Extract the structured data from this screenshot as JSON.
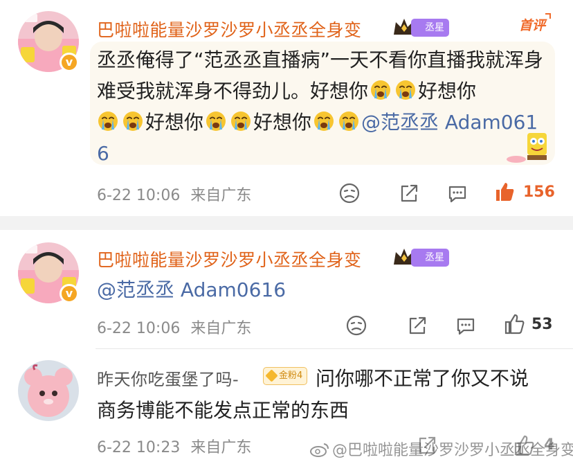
{
  "colors": {
    "username": "#e0631a",
    "mention": "#4a6aa5",
    "like_active": "#e8632b",
    "fan_tag": "#a77af0",
    "bubble": "#fcf8ef"
  },
  "comments": [
    {
      "username": "巴啦啦能量沙罗沙罗小丞丞全身变",
      "fan_tag": "丞星",
      "top_label": "首评",
      "text_parts": [
        "丞丞俺得了“范丞丞直播病”一天不看你直播我就浑身难受我就浑身不得劲儿。好想你",
        "好想你",
        "好想你",
        "好想你"
      ],
      "mention": "@范丞丞 Adam0616",
      "emoji": "crying-face",
      "time": "6-22 10:06",
      "location": "来自广东",
      "likes": "156",
      "liked": true
    },
    {
      "username": "巴啦啦能量沙罗沙罗小丞丞全身变",
      "fan_tag": "丞星",
      "mention": "@范丞丞 Adam0616",
      "time": "6-22 10:06",
      "location": "来自广东",
      "likes": "53",
      "liked": false
    },
    {
      "username": "昨天你吃蛋堡了吗-",
      "fan_tag": "金粉4",
      "text_line1": "问你哪不正常了你又不说",
      "text_line2": "商务博能不能发点正常的东西",
      "time": "6-22 10:23",
      "location": "来自广东",
      "likes": "4"
    }
  ],
  "watermark": "@巴啦啦能量沙罗沙罗小丞丞全身变"
}
